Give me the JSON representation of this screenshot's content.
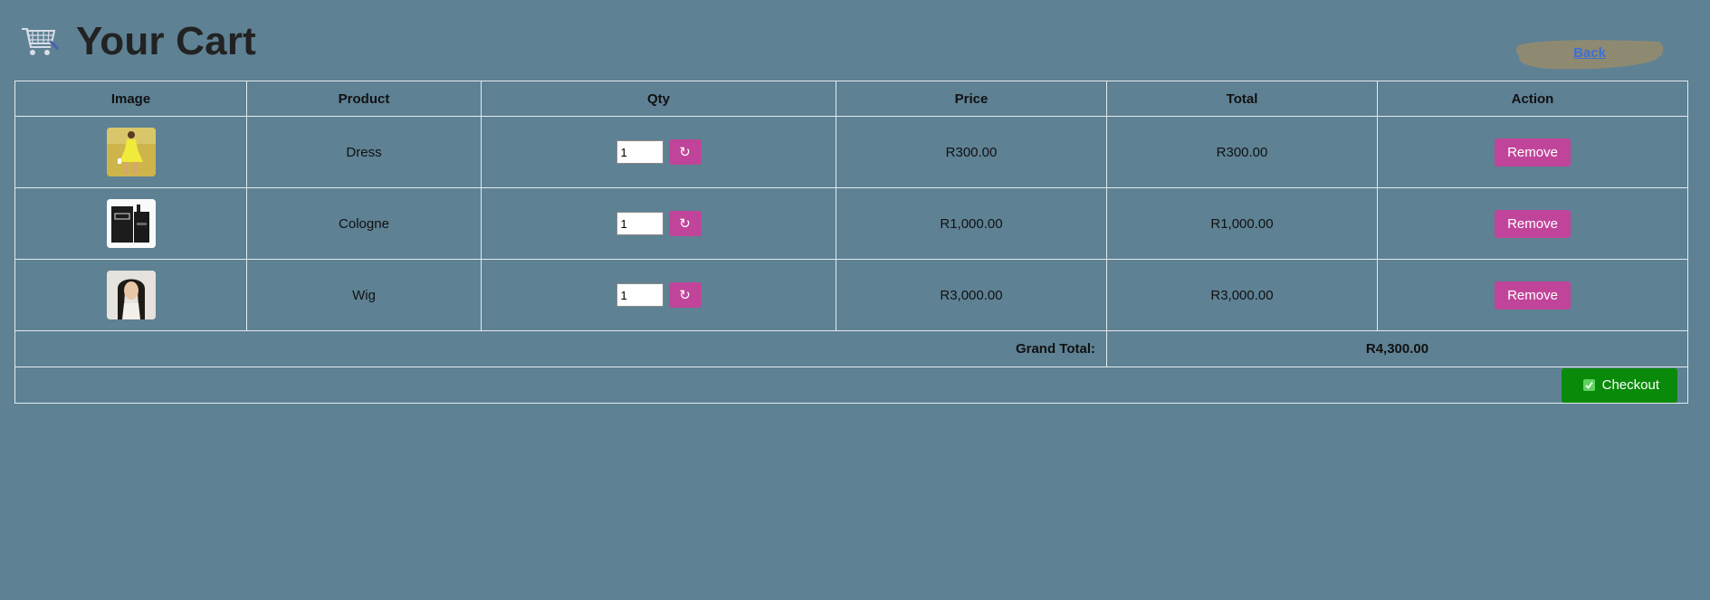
{
  "page": {
    "title": "Your Cart"
  },
  "nav": {
    "back_label": "Back"
  },
  "table": {
    "headers": [
      "Image",
      "Product",
      "Qty",
      "Price",
      "Total",
      "Action"
    ],
    "items": [
      {
        "image": "dress-image",
        "product": "Dress",
        "qty": "1",
        "price": "R300.00",
        "total": "R300.00",
        "action": "Remove"
      },
      {
        "image": "cologne-image",
        "product": "Cologne",
        "qty": "1",
        "price": "R1,000.00",
        "total": "R1,000.00",
        "action": "Remove"
      },
      {
        "image": "wig-image",
        "product": "Wig",
        "qty": "1",
        "price": "R3,000.00",
        "total": "R3,000.00",
        "action": "Remove"
      }
    ],
    "grand_total_label": "Grand Total:",
    "grand_total_value": "R4,300.00"
  },
  "checkout": {
    "label": "Checkout"
  },
  "icons": {
    "cart": "shopping-cart-icon",
    "refresh": "refresh-icon",
    "check": "checkbox-icon"
  },
  "colors": {
    "background": "#5e8194",
    "accent": "#c0459a",
    "checkout": "#0a8a0a",
    "link": "#3d6fd6"
  }
}
